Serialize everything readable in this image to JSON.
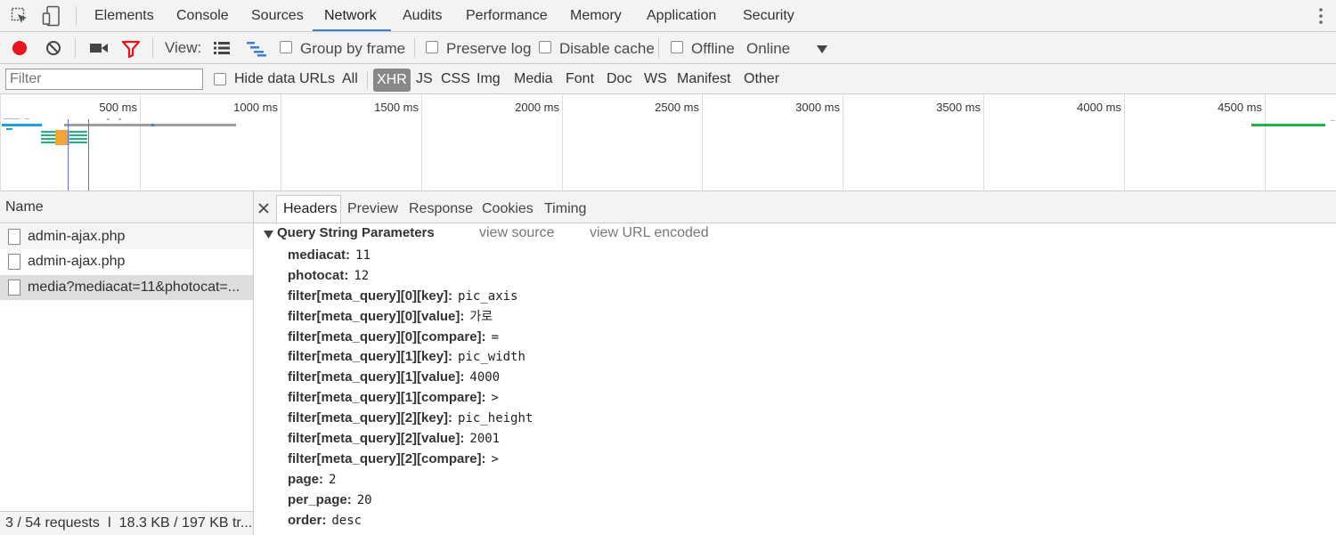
{
  "tabs": [
    "Elements",
    "Console",
    "Sources",
    "Network",
    "Audits",
    "Performance",
    "Memory",
    "Application",
    "Security"
  ],
  "toolbar": {
    "view_label": "View:",
    "group_by_frame": "Group by frame",
    "preserve_log": "Preserve log",
    "disable_cache": "Disable cache",
    "offline": "Offline",
    "throttle_value": "Online"
  },
  "filter_bar": {
    "filter_placeholder": "Filter",
    "hide_data_urls": "Hide data URLs",
    "types": [
      "All",
      "XHR",
      "JS",
      "CSS",
      "Img",
      "Media",
      "Font",
      "Doc",
      "WS",
      "Manifest",
      "Other"
    ],
    "selected_type": "XHR"
  },
  "timeline": {
    "ticks": [
      "500 ms",
      "1000 ms",
      "1500 ms",
      "2000 ms",
      "2500 ms",
      "3000 ms",
      "3500 ms",
      "4000 ms",
      "4500 ms"
    ]
  },
  "requests": {
    "header": "Name",
    "items": [
      "admin-ajax.php",
      "admin-ajax.php",
      "media?mediacat=11&photocat=..."
    ],
    "selected_index": 2,
    "summary": "3 / 54 requests  ǀ  18.3 KB / 197 KB tr..."
  },
  "details": {
    "tabs": [
      "Headers",
      "Preview",
      "Response",
      "Cookies",
      "Timing"
    ],
    "active_tab": "Headers",
    "section_title": "Query String Parameters",
    "view_source": "view source",
    "view_url_encoded": "view URL encoded",
    "params": [
      {
        "key": "mediacat:",
        "value": "11"
      },
      {
        "key": "photocat:",
        "value": "12"
      },
      {
        "key": "filter[meta_query][0][key]:",
        "value": "pic_axis"
      },
      {
        "key": "filter[meta_query][0][value]:",
        "value": "가로"
      },
      {
        "key": "filter[meta_query][0][compare]:",
        "value": "="
      },
      {
        "key": "filter[meta_query][1][key]:",
        "value": "pic_width"
      },
      {
        "key": "filter[meta_query][1][value]:",
        "value": "4000"
      },
      {
        "key": "filter[meta_query][1][compare]:",
        "value": ">"
      },
      {
        "key": "filter[meta_query][2][key]:",
        "value": "pic_height"
      },
      {
        "key": "filter[meta_query][2][value]:",
        "value": "2001"
      },
      {
        "key": "filter[meta_query][2][compare]:",
        "value": ">"
      },
      {
        "key": "page:",
        "value": "2"
      },
      {
        "key": "per_page:",
        "value": "20"
      },
      {
        "key": "order:",
        "value": "desc"
      }
    ]
  },
  "colors": {
    "record": "#e8151b",
    "filter_active": "#e8151b",
    "tab_underline": "#3b7fd9",
    "selected_row": "#dddddd"
  }
}
